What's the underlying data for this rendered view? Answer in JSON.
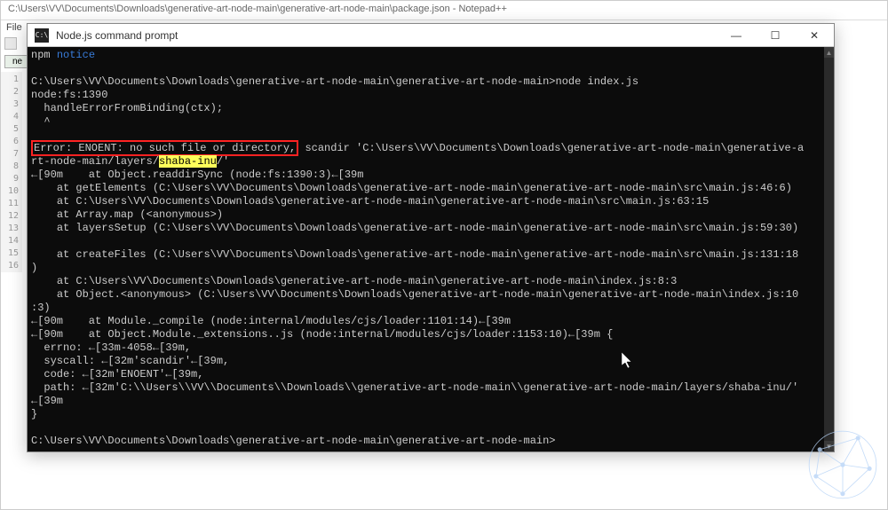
{
  "npp": {
    "title": "C:\\Users\\VV\\Documents\\Downloads\\generative-art-node-main\\generative-art-node-main\\package.json - Notepad++",
    "menu_file": "File",
    "tab": "ne",
    "line_numbers": [
      "1",
      "2",
      "3",
      "4",
      "5",
      "6",
      "7",
      "8",
      "9",
      "10",
      "11",
      "12",
      "13",
      "14",
      "15",
      "16"
    ]
  },
  "cmd": {
    "title": "Node.js command prompt",
    "minimize": "—",
    "maximize": "☐",
    "close": "✕",
    "l1a": "npm ",
    "l1b": "notice",
    "l2": "",
    "l3": "C:\\Users\\VV\\Documents\\Downloads\\generative-art-node-main\\generative-art-node-main>node index.js",
    "l4": "node:fs:1390",
    "l5": "  handleErrorFromBinding(ctx);",
    "l6": "  ^",
    "l7": "",
    "err_boxed": "Error: ENOENT: no such file or directory,",
    "err_after": " scandir 'C:\\Users\\VV\\Documents\\Downloads\\generative-art-node-main\\generative-a",
    "l9a": "rt-node-main/layers/",
    "l9_hl": "shaba-inu",
    "l9b": "/'",
    "l10": "←[90m    at Object.readdirSync (node:fs:1390:3)←[39m",
    "l11": "    at getElements (C:\\Users\\VV\\Documents\\Downloads\\generative-art-node-main\\generative-art-node-main\\src\\main.js:46:6)",
    "l12": "    at C:\\Users\\VV\\Documents\\Downloads\\generative-art-node-main\\generative-art-node-main\\src\\main.js:63:15",
    "l13": "    at Array.map (<anonymous>)",
    "l14": "    at layersSetup (C:\\Users\\VV\\Documents\\Downloads\\generative-art-node-main\\generative-art-node-main\\src\\main.js:59:30)",
    "l15": "",
    "l16": "    at createFiles (C:\\Users\\VV\\Documents\\Downloads\\generative-art-node-main\\generative-art-node-main\\src\\main.js:131:18",
    "l17": ")",
    "l18": "    at C:\\Users\\VV\\Documents\\Downloads\\generative-art-node-main\\generative-art-node-main\\index.js:8:3",
    "l19": "    at Object.<anonymous> (C:\\Users\\VV\\Documents\\Downloads\\generative-art-node-main\\generative-art-node-main\\index.js:10",
    "l20": ":3)",
    "l21": "←[90m    at Module._compile (node:internal/modules/cjs/loader:1101:14)←[39m",
    "l22": "←[90m    at Object.Module._extensions..js (node:internal/modules/cjs/loader:1153:10)←[39m {",
    "l23": "  errno: ←[33m-4058←[39m,",
    "l24": "  syscall: ←[32m'scandir'←[39m,",
    "l25": "  code: ←[32m'ENOENT'←[39m,",
    "l26": "  path: ←[32m'C:\\\\Users\\\\VV\\\\Documents\\\\Downloads\\\\generative-art-node-main\\\\generative-art-node-main/layers/shaba-inu/'",
    "l27": "←[39m",
    "l28": "}",
    "l29": "",
    "l30": "C:\\Users\\VV\\Documents\\Downloads\\generative-art-node-main\\generative-art-node-main>"
  }
}
